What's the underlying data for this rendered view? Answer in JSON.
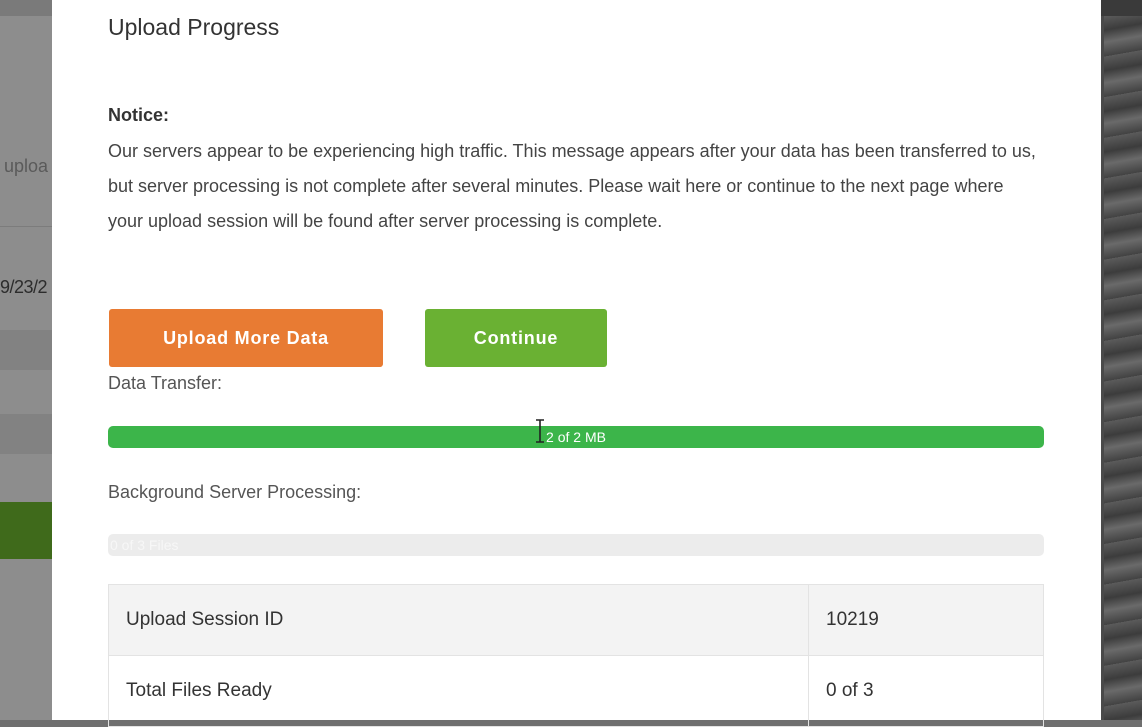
{
  "background": {
    "partial_text": "uploa",
    "partial_date": "9/23/2"
  },
  "modal": {
    "title": "Upload Progress",
    "notice_label": "Notice:",
    "notice_text": "Our servers appear to be experiencing high traffic. This message appears after your data has been transferred to us, but server processing is not complete after several minutes. Please wait here or continue to the next page where your upload session will be found after server processing is complete.",
    "buttons": {
      "upload_more": "Upload More Data",
      "continue": "Continue"
    },
    "data_transfer": {
      "label": "Data Transfer:",
      "progress_text": "2 of 2 MB",
      "fraction": 1.0
    },
    "background_processing": {
      "label": "Background Server Processing:",
      "progress_text": "0 of 3 Files",
      "fraction": 0.0
    },
    "table": {
      "rows": [
        {
          "label": "Upload Session ID",
          "value": "10219"
        },
        {
          "label": "Total Files Ready",
          "value": "0 of 3"
        }
      ]
    }
  },
  "colors": {
    "upload_button": "#e87b33",
    "continue_button": "#6ab133",
    "progress_fill": "#3cb54a"
  }
}
